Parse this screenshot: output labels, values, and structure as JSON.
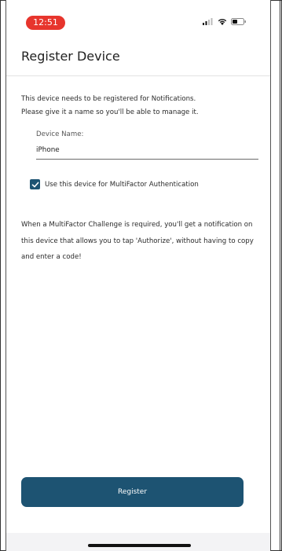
{
  "status_bar": {
    "time": "12:51",
    "icons": [
      "signal-icon",
      "wifi-icon",
      "battery-icon"
    ],
    "time_pill_color": "#e7352d"
  },
  "header": {
    "title": "Register Device"
  },
  "intro": {
    "line1": "This device needs to be registered for Notifications.",
    "line2": "Please give it a name so you'll be able to manage it."
  },
  "device_name": {
    "label": "Device Name:",
    "value": "iPhone"
  },
  "mfa_option": {
    "label": "Use this device for MultiFactor Authentication",
    "checked": true
  },
  "explainer": {
    "text": "When a MultiFactor Challenge is required, you'll get a notification on this device that allows you to tap 'Authorize', without having to copy and enter a code!"
  },
  "actions": {
    "register_label": "Register"
  },
  "colors": {
    "accent": "#1d5372",
    "background": "#ffffff"
  }
}
